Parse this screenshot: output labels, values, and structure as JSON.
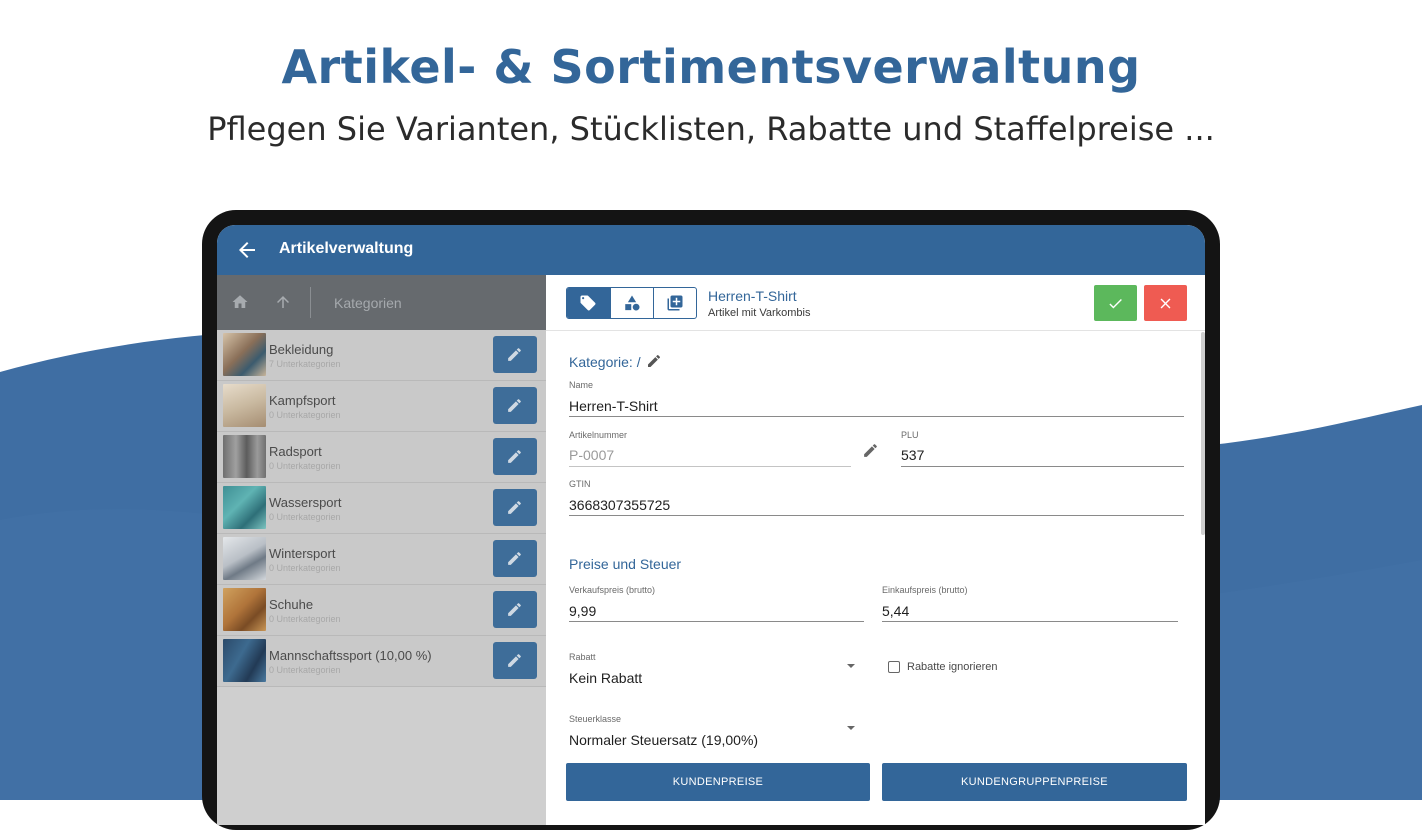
{
  "hero": {
    "title": "Artikel- & Sortimentsverwaltung",
    "subtitle": "Pflegen Sie Varianten, Stücklisten, Rabatte und Staffelpreise ..."
  },
  "colors": {
    "accent": "#336699",
    "confirm": "#5cb85c",
    "cancel": "#ef5b52"
  },
  "appbar": {
    "title": "Artikelverwaltung",
    "back_icon": "arrow-left-icon"
  },
  "left_pane": {
    "toolbar": {
      "home_icon": "home-icon",
      "up_icon": "arrow-up-icon",
      "label": "Kategorien"
    },
    "items": [
      {
        "name": "Bekleidung",
        "sub": "7 Unterkategorien"
      },
      {
        "name": "Kampfsport",
        "sub": "0 Unterkategorien"
      },
      {
        "name": "Radsport",
        "sub": "0 Unterkategorien"
      },
      {
        "name": "Wassersport",
        "sub": "0 Unterkategorien"
      },
      {
        "name": "Wintersport",
        "sub": "0 Unterkategorien"
      },
      {
        "name": "Schuhe",
        "sub": "0 Unterkategorien"
      },
      {
        "name": "Mannschaftssport (10,00 %)",
        "sub": "0 Unterkategorien"
      }
    ]
  },
  "detail": {
    "title": "Herren-T-Shirt",
    "subtitle": "Artikel mit Varkombis",
    "tabs": [
      "tag-icon",
      "shapes-icon",
      "library-add-icon"
    ],
    "category_label": "Kategorie: /",
    "name_label": "Name",
    "name_value": "Herren-T-Shirt",
    "article_no_label": "Artikelnummer",
    "article_no_value": "P-0007",
    "plu_label": "PLU",
    "plu_value": "537",
    "gtin_label": "GTIN",
    "gtin_value": "3668307355725",
    "prices_section": "Preise und Steuer",
    "sale_price_label": "Verkaufspreis (brutto)",
    "sale_price_value": "9,99",
    "purchase_price_label": "Einkaufspreis (brutto)",
    "purchase_price_value": "5,44",
    "discount_label": "Rabatt",
    "discount_value": "Kein Rabatt",
    "ignore_discounts_label": "Rabatte ignorieren",
    "tax_label": "Steuerklasse",
    "tax_value": "Normaler Steuersatz (19,00%)",
    "customer_prices_button": "KUNDENPREISE",
    "customer_group_prices_button": "KUNDENGRUPPENPREISE"
  }
}
